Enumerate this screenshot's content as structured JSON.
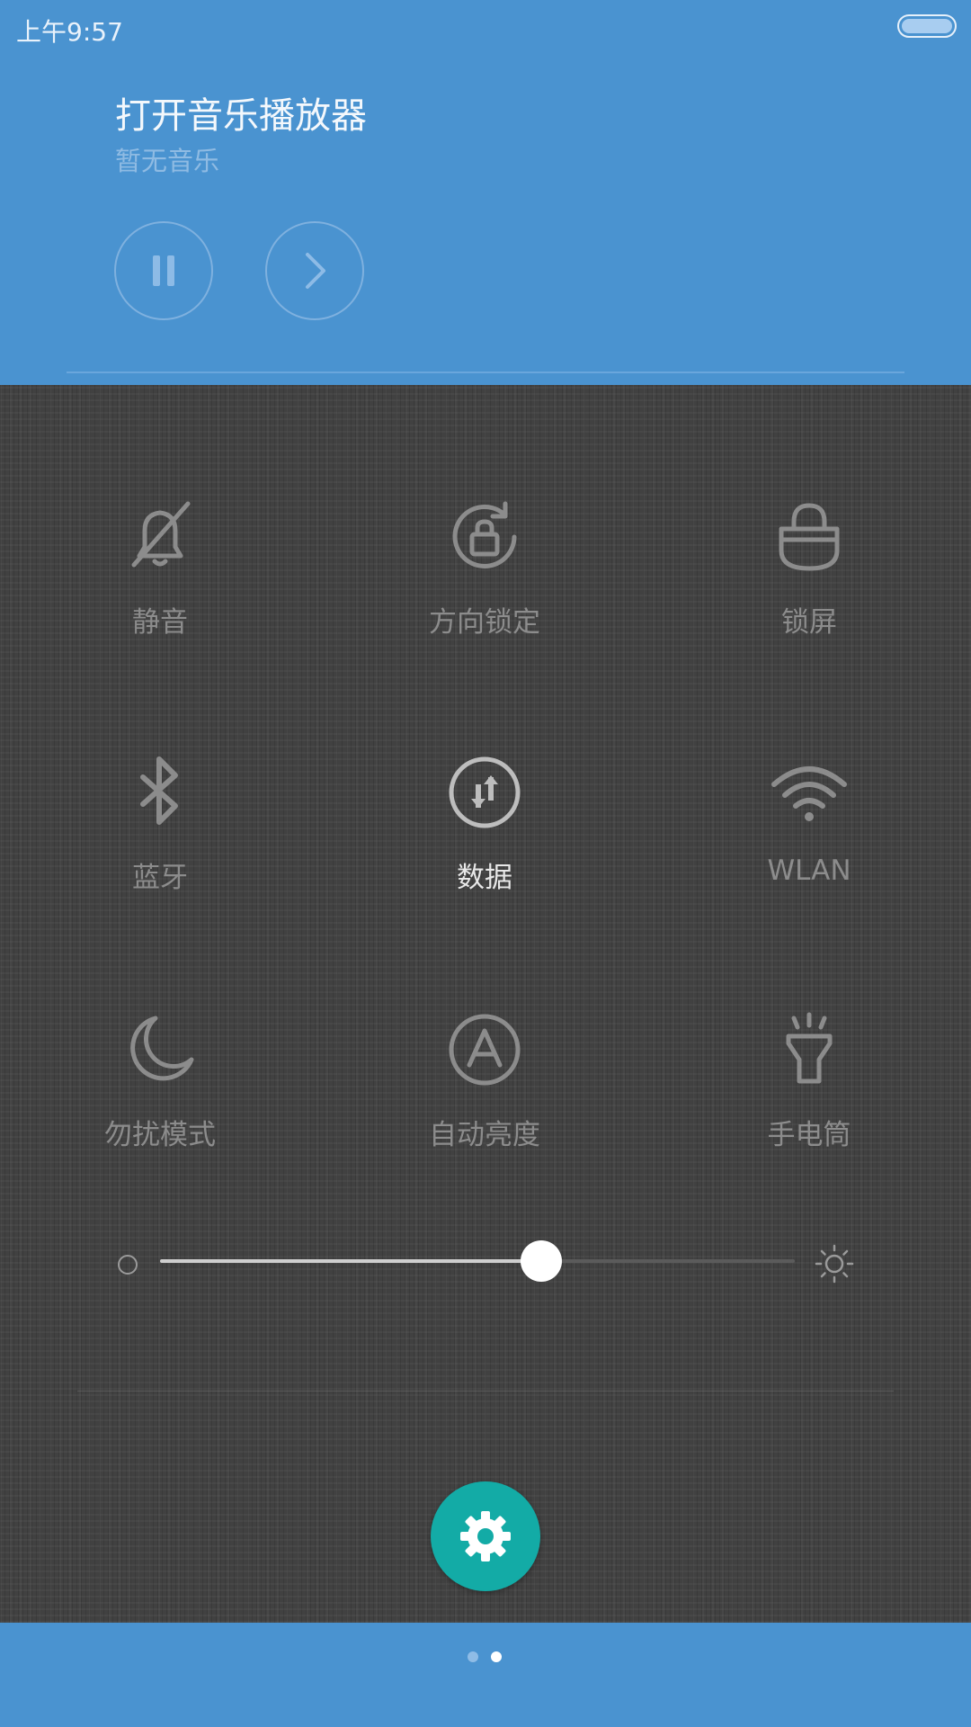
{
  "status_bar": {
    "time": "上午9:57",
    "battery_level": 1.0
  },
  "music": {
    "title": "打开音乐播放器",
    "subtitle": "暂无音乐",
    "pause_icon": "pause-icon",
    "next_icon": "chevron-right-icon"
  },
  "toggles": [
    {
      "label": "静音",
      "icon": "bell-off-icon",
      "active": false
    },
    {
      "label": "方向锁定",
      "icon": "rotation-lock-icon",
      "active": false
    },
    {
      "label": "锁屏",
      "icon": "lock-icon",
      "active": false
    },
    {
      "label": "蓝牙",
      "icon": "bluetooth-icon",
      "active": false
    },
    {
      "label": "数据",
      "icon": "mobile-data-icon",
      "active": true
    },
    {
      "label": "WLAN",
      "icon": "wifi-icon",
      "active": false
    },
    {
      "label": "勿扰模式",
      "icon": "moon-icon",
      "active": false
    },
    {
      "label": "自动亮度",
      "icon": "auto-brightness-icon",
      "active": false
    },
    {
      "label": "手电筒",
      "icon": "flashlight-icon",
      "active": false
    }
  ],
  "brightness": {
    "level": 0.6
  },
  "pager": {
    "pages": 2,
    "current": 2
  },
  "colors": {
    "header_blue": "#4a93d0",
    "panel_dark": "#414141",
    "settings_teal": "#13aba6"
  }
}
